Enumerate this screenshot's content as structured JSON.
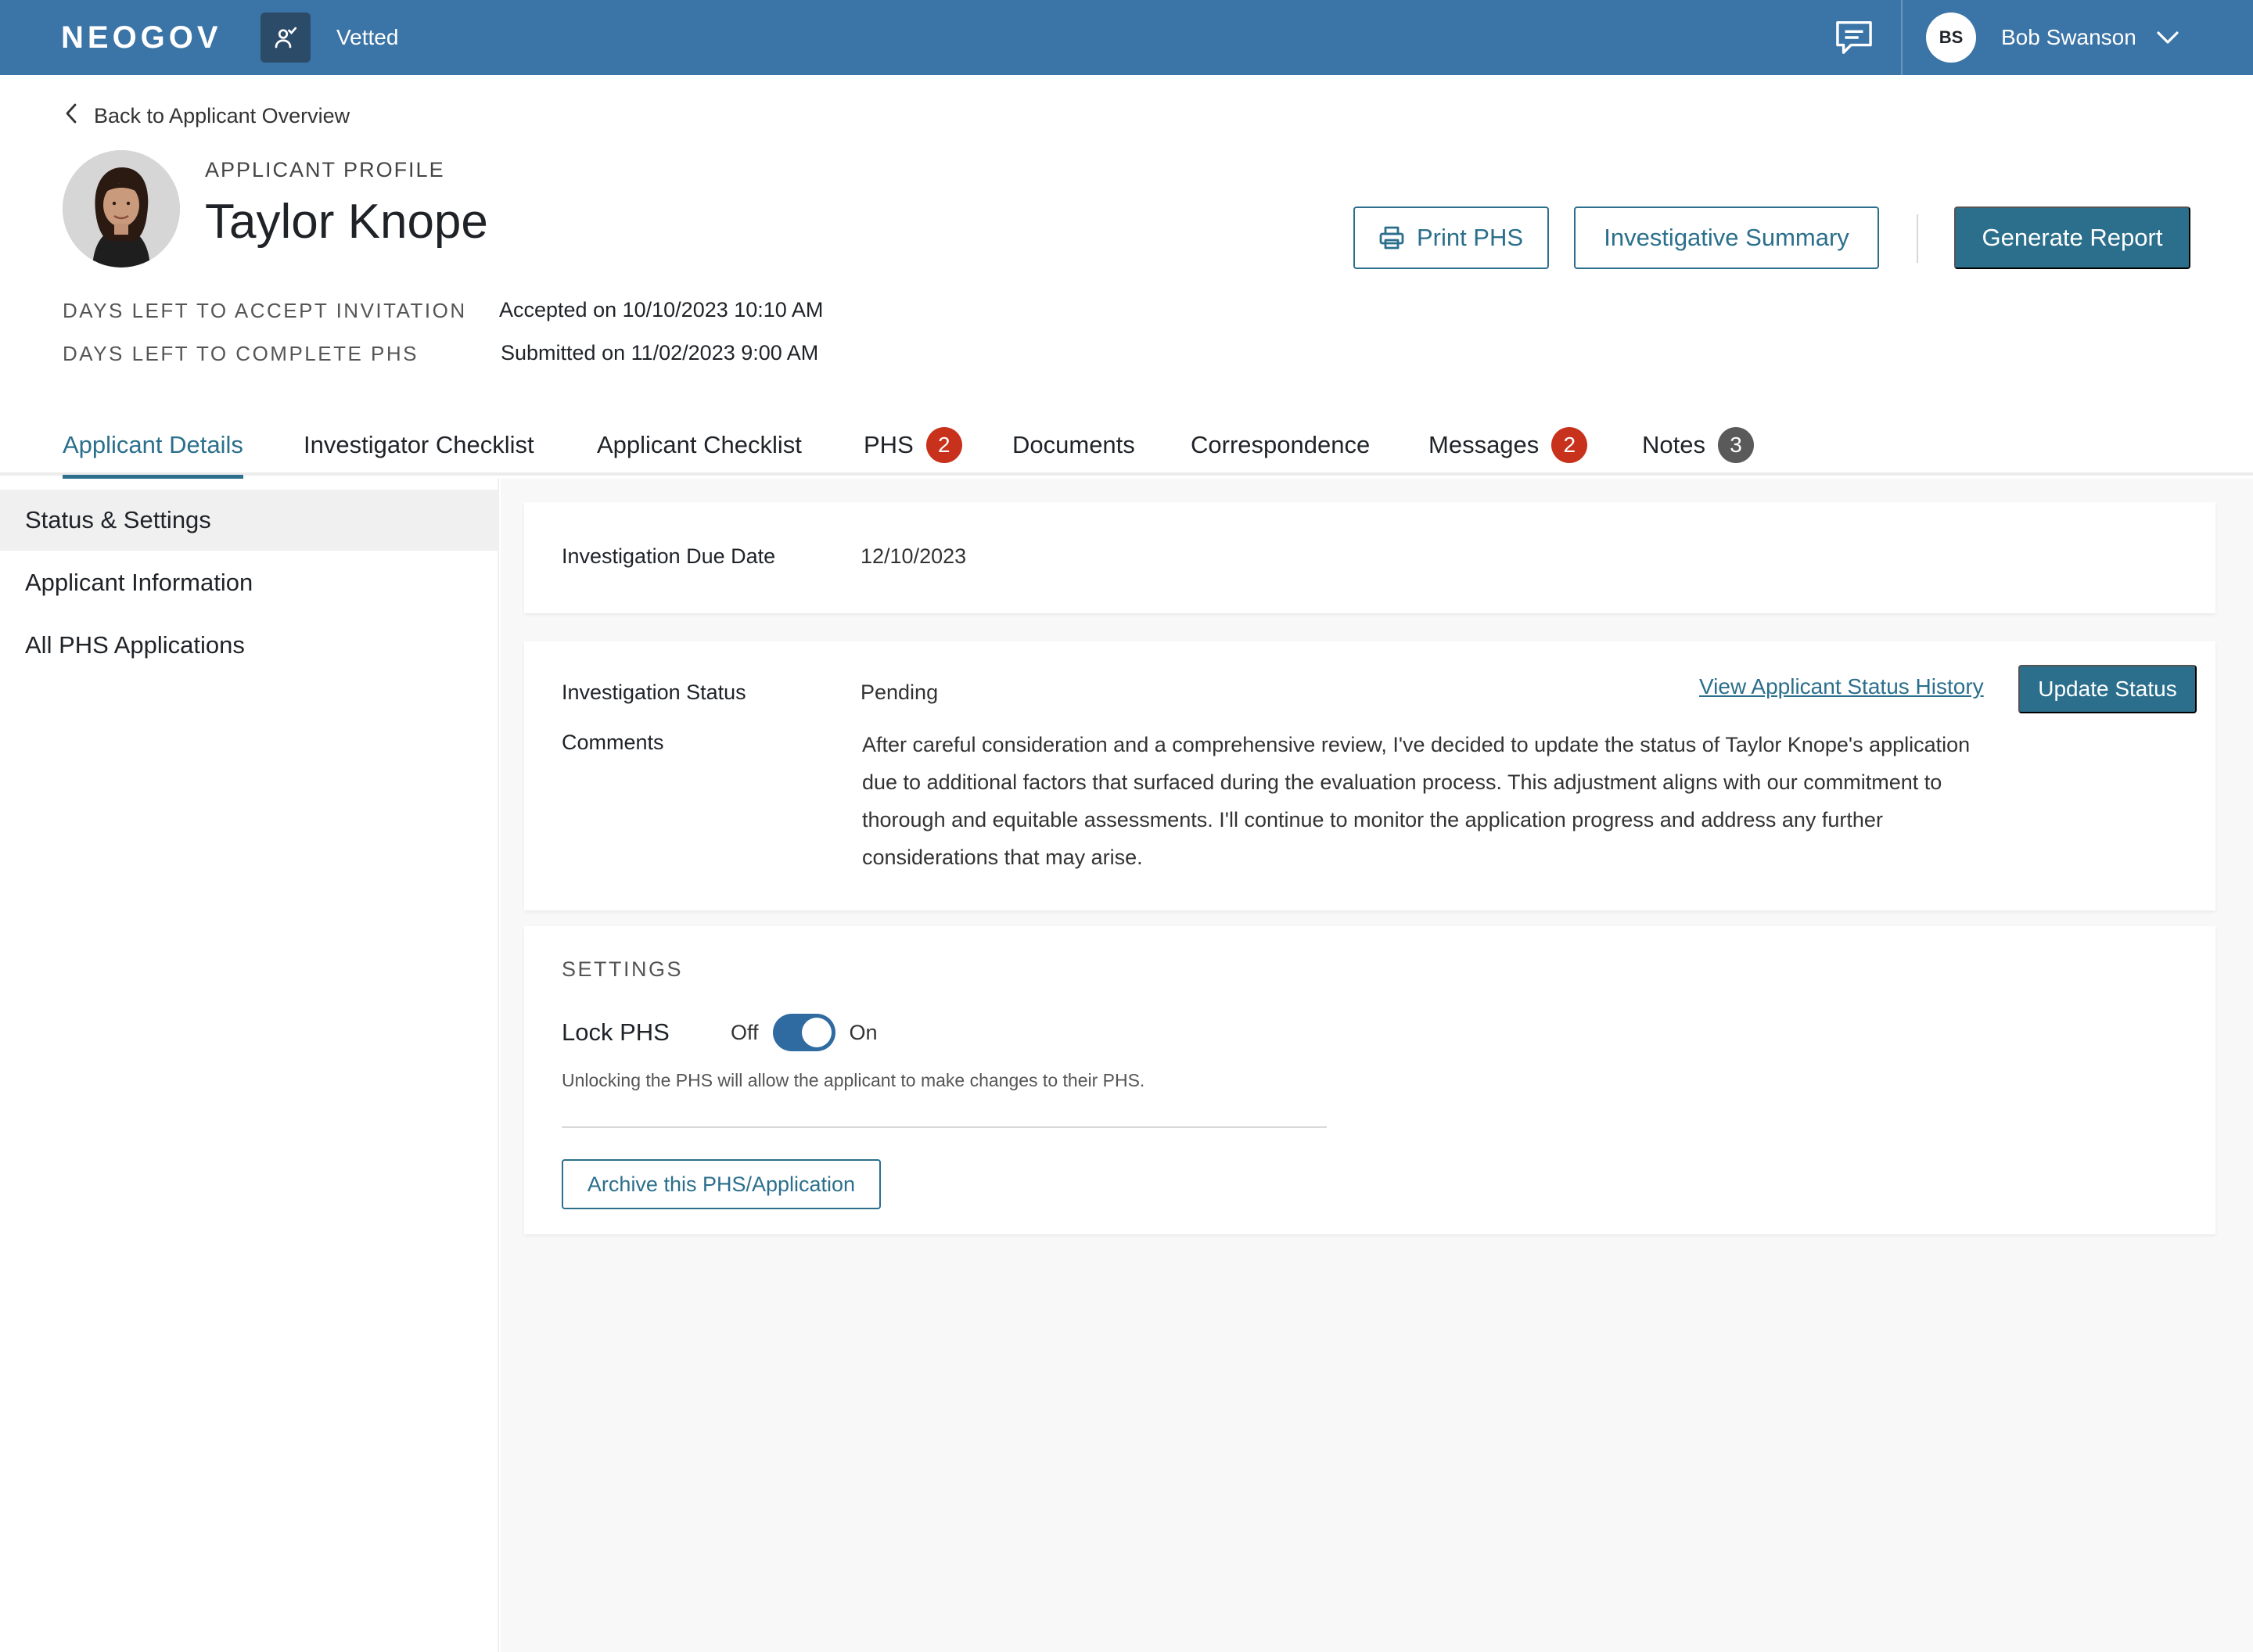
{
  "topbar": {
    "brand": "NEOGOV",
    "app_name": "Vetted",
    "app_icon": "person-check-icon",
    "chat_icon": "chat-icon",
    "user": {
      "initials": "BS",
      "name": "Bob Swanson",
      "menu_icon": "chevron-down-icon"
    }
  },
  "header": {
    "back_link": "Back to Applicant Overview",
    "eyebrow": "APPLICANT PROFILE",
    "name": "Taylor Knope",
    "meta": [
      {
        "label": "DAYS LEFT TO ACCEPT INVITATION",
        "value": "Accepted on 10/10/2023 10:10 AM"
      },
      {
        "label": "DAYS LEFT TO COMPLETE PHS",
        "value": "Submitted on 11/02/2023 9:00 AM"
      }
    ],
    "buttons": {
      "print": "Print PHS",
      "summary": "Investigative Summary",
      "report": "Generate Report"
    }
  },
  "tabs": [
    {
      "label": "Applicant Details",
      "active": true
    },
    {
      "label": "Investigator Checklist"
    },
    {
      "label": "Applicant Checklist"
    },
    {
      "label": "PHS",
      "badge": "2",
      "badge_color": "#c8311c"
    },
    {
      "label": "Documents"
    },
    {
      "label": "Correspondence"
    },
    {
      "label": "Messages",
      "badge": "2",
      "badge_color": "#c8311c"
    },
    {
      "label": "Notes",
      "badge": "3",
      "badge_color": "#5a5a5a"
    }
  ],
  "sidebar": {
    "items": [
      {
        "label": "Status & Settings",
        "active": true
      },
      {
        "label": "Applicant Information"
      },
      {
        "label": "All PHS Applications"
      }
    ]
  },
  "due_card": {
    "label": "Investigation Due Date",
    "value": "12/10/2023"
  },
  "status_card": {
    "status_label": "Investigation Status",
    "status_value": "Pending",
    "history_link": "View Applicant Status History",
    "update_button": "Update Status",
    "comments_label": "Comments",
    "comments": "After careful consideration and a comprehensive review, I've decided to update the status of Taylor Knope's application due to additional factors that surfaced during the evaluation process. This adjustment aligns with our commitment to thorough and equitable assessments. I'll continue to monitor the application progress and address any further considerations that may arise."
  },
  "settings_card": {
    "title": "SETTINGS",
    "lock_label": "Lock PHS",
    "off_label": "Off",
    "on_label": "On",
    "lock_on": true,
    "hint": "Unlocking the PHS will allow the applicant to make changes to their PHS.",
    "archive_button": "Archive this PHS/Application"
  },
  "colors": {
    "topbar": "#3b74a6",
    "accent": "#2b6f8c",
    "badge_red": "#c8311c",
    "badge_gray": "#5a5a5a"
  }
}
